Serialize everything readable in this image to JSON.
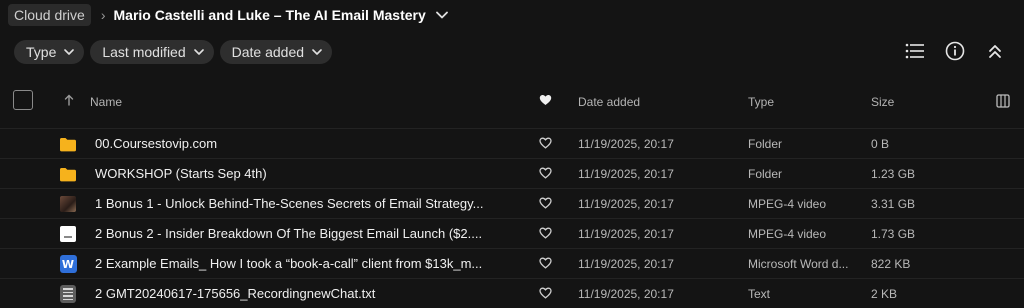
{
  "breadcrumb": {
    "root": "Cloud drive",
    "current": "Mario Castelli and Luke – The AI Email Mastery"
  },
  "filters": [
    {
      "label": "Type"
    },
    {
      "label": "Last modified"
    },
    {
      "label": "Date added"
    }
  ],
  "table": {
    "headers": {
      "name": "Name",
      "date_added": "Date added",
      "type": "Type",
      "size": "Size"
    },
    "rows": [
      {
        "icon": "folder-icon",
        "name": "00.Coursestovip.com",
        "date": "11/19/2025, 20:17",
        "type": "Folder",
        "size": "0 B"
      },
      {
        "icon": "folder-icon",
        "name": "WORKSHOP (Starts Sep 4th)",
        "date": "11/19/2025, 20:17",
        "type": "Folder",
        "size": "1.23 GB"
      },
      {
        "icon": "video-thumbnail-icon",
        "name": "1 Bonus 1 - Unlock Behind-The-Scenes Secrets of Email Strategy...",
        "date": "11/19/2025, 20:17",
        "type": "MPEG-4 video",
        "size": "3.31 GB"
      },
      {
        "icon": "document-thumbnail-icon",
        "name": "2 Bonus 2 - Insider Breakdown Of The Biggest Email Launch ($2....",
        "date": "11/19/2025, 20:17",
        "type": "MPEG-4 video",
        "size": "1.73 GB"
      },
      {
        "icon": "word-document-icon",
        "name": "2 Example Emails_ How I took a “book-a-call” client from $13k_m...",
        "date": "11/19/2025, 20:17",
        "type": "Microsoft Word d...",
        "size": "822 KB"
      },
      {
        "icon": "text-file-icon",
        "name": "2 GMT20240617-175656_RecordingnewChat.txt",
        "date": "11/19/2025, 20:17",
        "type": "Text",
        "size": "2 KB"
      }
    ]
  },
  "colors": {
    "background": "#141414",
    "pill": "#2e2e2e",
    "folder": "#f6b21c",
    "word": "#2f6fd9"
  }
}
